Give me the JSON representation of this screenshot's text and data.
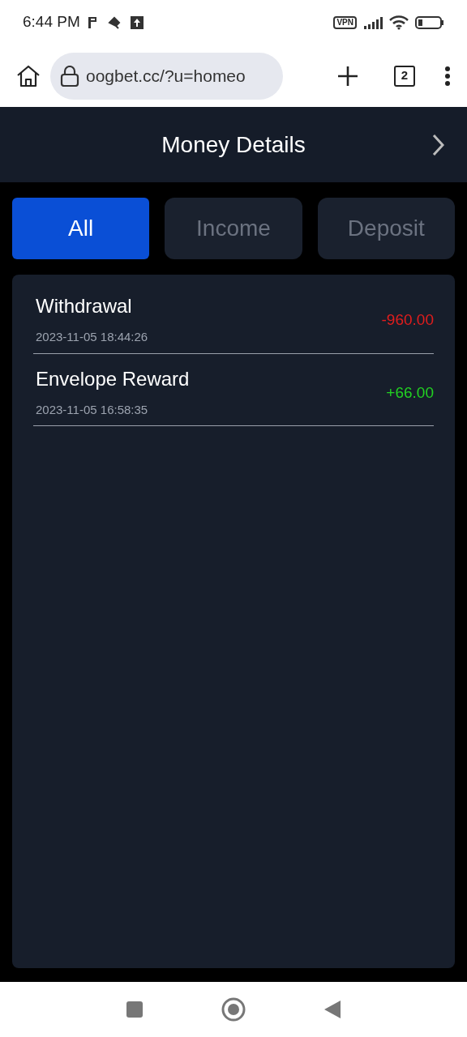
{
  "status_bar": {
    "time": "6:44 PM",
    "vpn": "VPN"
  },
  "browser": {
    "url": "oogbet.cc/?u=homeo",
    "tab_count": "2"
  },
  "header": {
    "title": "Money Details"
  },
  "tabs": [
    {
      "label": "All",
      "selected": true
    },
    {
      "label": "Income",
      "selected": false
    },
    {
      "label": "Deposit",
      "selected": false
    }
  ],
  "transactions": [
    {
      "title": "Withdrawal",
      "time": "2023-11-05 18:44:26",
      "amount": "-960.00",
      "kind": "debit"
    },
    {
      "title": "Envelope Reward",
      "time": "2023-11-05 16:58:35",
      "amount": "+66.00",
      "kind": "credit"
    }
  ]
}
